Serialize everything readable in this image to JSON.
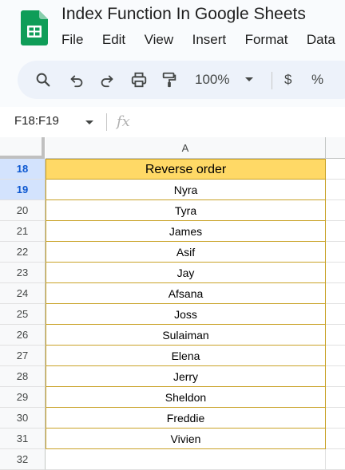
{
  "app": {
    "doc_title": "Index Function In Google Sheets",
    "logo_icon": "google-sheets-logo",
    "menu": [
      "File",
      "Edit",
      "View",
      "Insert",
      "Format",
      "Data"
    ]
  },
  "toolbar": {
    "icons": [
      "search-icon",
      "undo-icon",
      "redo-icon",
      "print-icon",
      "paint-format-icon"
    ],
    "zoom": "100%",
    "currency": "$",
    "percent": "%"
  },
  "formula_bar": {
    "name_box": "F18:F19",
    "fx": "fx",
    "content": ""
  },
  "grid": {
    "column_header": "A",
    "selected_rows": [
      "18",
      "19"
    ],
    "rows": [
      {
        "num": "18",
        "value": "Reverse order"
      },
      {
        "num": "19",
        "value": "Nyra"
      },
      {
        "num": "20",
        "value": "Tyra"
      },
      {
        "num": "21",
        "value": "James"
      },
      {
        "num": "22",
        "value": "Asif"
      },
      {
        "num": "23",
        "value": "Jay"
      },
      {
        "num": "24",
        "value": "Afsana"
      },
      {
        "num": "25",
        "value": "Joss"
      },
      {
        "num": "26",
        "value": "Sulaiman"
      },
      {
        "num": "27",
        "value": "Elena"
      },
      {
        "num": "28",
        "value": "Jerry"
      },
      {
        "num": "29",
        "value": "Sheldon"
      },
      {
        "num": "30",
        "value": "Freddie"
      },
      {
        "num": "31",
        "value": "Vivien"
      },
      {
        "num": "32",
        "value": ""
      }
    ]
  },
  "colors": {
    "header_fill": "#ffd966",
    "cell_border": "#c9a227",
    "selected_row_header": "#d3e3fd"
  }
}
